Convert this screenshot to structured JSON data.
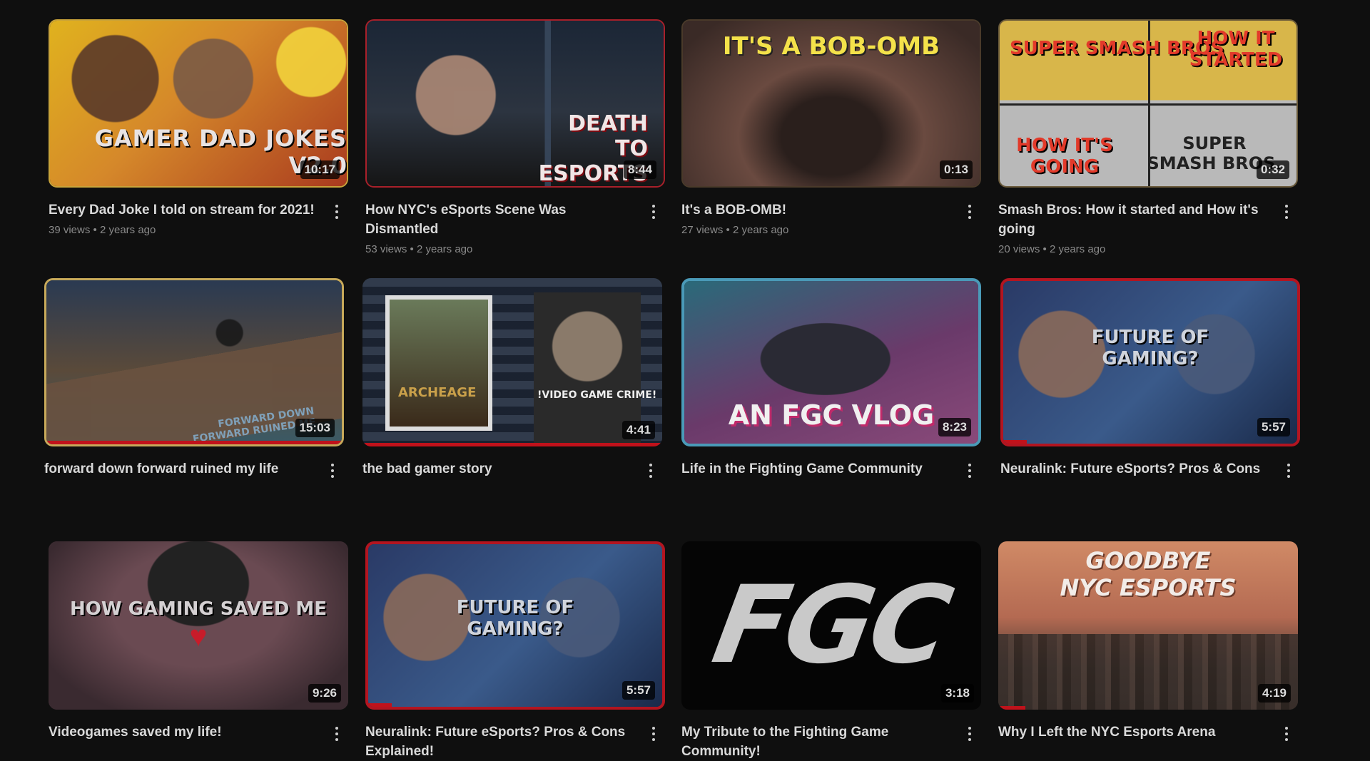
{
  "videos": [
    {
      "title": "Every Dad Joke I told on stream for 2021!",
      "views": "39 views",
      "age": "2 years ago",
      "duration": "10:17",
      "overlay": [
        "GAMER DAD JOKES",
        "V2.0"
      ],
      "progress": 0
    },
    {
      "title": "How NYC's eSports Scene Was Dismantled",
      "views": "53 views",
      "age": "2 years ago",
      "duration": "8:44",
      "overlay": [
        "DEATH",
        "TO",
        "ESPORTS"
      ],
      "progress": 0
    },
    {
      "title": "It's a BOB-OMB!",
      "views": "27 views",
      "age": "2 years ago",
      "duration": "0:13",
      "overlay": [
        "IT'S A BOB-OMB"
      ],
      "progress": 0
    },
    {
      "title": "Smash Bros: How it started and How it's going",
      "views": "20 views",
      "age": "2 years ago",
      "duration": "0:32",
      "overlay": [
        "SUPER SMASH BROS",
        "HOW IT STARTED",
        "HOW IT'S GOING",
        "SUPER SMASH BROS."
      ],
      "progress": 0
    },
    {
      "title": "forward down forward ruined my life",
      "views": "",
      "age": "",
      "duration": "15:03",
      "overlay": [
        "FORWARD DOWN",
        "FORWARD RUINED ME"
      ],
      "progress": 1.0
    },
    {
      "title": "the bad gamer story",
      "views": "",
      "age": "",
      "duration": "4:41",
      "overlay": [
        "ARCHEAGE",
        "!VIDEO GAME CRIME!"
      ],
      "progress": 1.0
    },
    {
      "title": "Life in the Fighting Game Community",
      "views": "",
      "age": "",
      "duration": "8:23",
      "overlay": [
        "AN FGC VLOG"
      ],
      "progress": 0
    },
    {
      "title": "Neuralink: Future eSports? Pros & Cons",
      "views": "",
      "age": "",
      "duration": "5:57",
      "overlay": [
        "FUTURE OF",
        "GAMING?"
      ],
      "progress": 0.08
    },
    {
      "title": "Videogames saved my life!",
      "views": "",
      "age": "",
      "duration": "9:26",
      "overlay": [
        "HOW GAMING SAVED ME"
      ],
      "progress": 0
    },
    {
      "title": "Neuralink: Future eSports? Pros & Cons Explained!",
      "views": "",
      "age": "",
      "duration": "5:57",
      "overlay": [
        "FUTURE OF",
        "GAMING?"
      ],
      "progress": 0.08
    },
    {
      "title": "My Tribute to the Fighting Game Community!",
      "views": "",
      "age": "",
      "duration": "3:18",
      "overlay": [
        "FGC"
      ],
      "progress": 0
    },
    {
      "title": "Why I Left the NYC Esports Arena",
      "views": "",
      "age": "",
      "duration": "4:19",
      "overlay": [
        "GOODBYE",
        "NYC ESPORTS"
      ],
      "progress": 0.09
    }
  ],
  "separator": "•",
  "colors": {
    "background": "#0f0f0f",
    "progress": "#c0121b",
    "title": "#d9d9d9",
    "meta": "#8a8a8a"
  }
}
